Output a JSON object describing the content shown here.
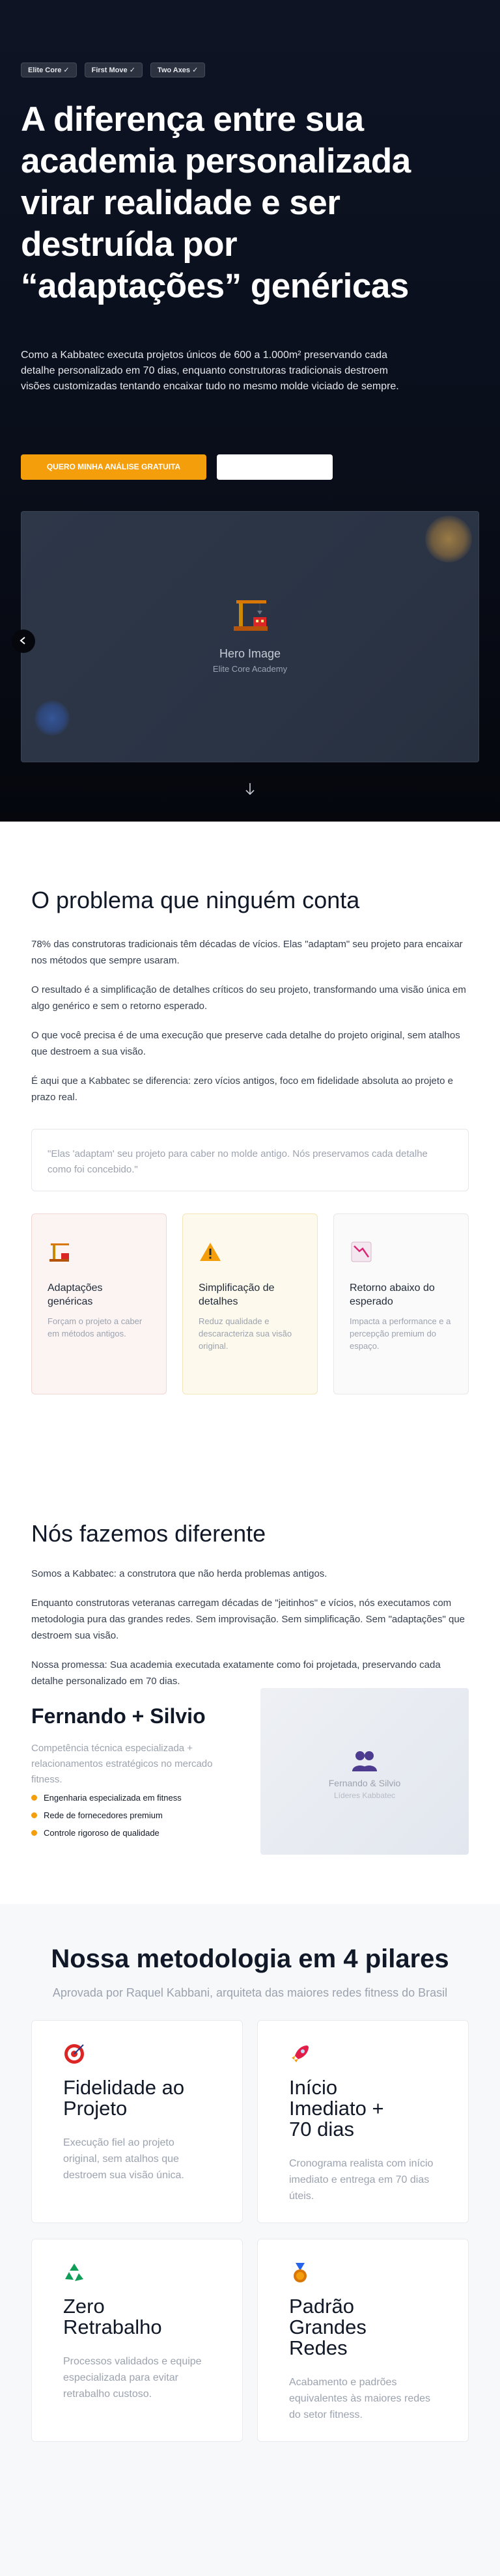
{
  "hero": {
    "badges": [
      "Elite Core ✓",
      "First Move ✓",
      "Two Axes ✓"
    ],
    "title_lines": [
      "A diferença entre sua",
      "academia personalizada",
      "virar realidade e ser",
      "destruída por",
      "“adaptações” genéricas"
    ],
    "subtitle": "Como a Kabbatec executa projetos únicos de 600 a 1.000m² preservando cada detalhe personalizado em 70 dias, enquanto construtoras tradicionais destroem visões customizadas tentando encaixar tudo no mesmo molde viciado de sempre.",
    "cta_primary": "QUERO MINHA ANÁLISE GRATUITA",
    "cta_secondary": "",
    "image": {
      "title": "Hero Image",
      "caption": "Elite Core Academy"
    },
    "side_arrow": "←",
    "down_arrow": "↓"
  },
  "problem": {
    "title": "O problema que ninguém conta",
    "paragraphs": [
      "78% das construtoras tradicionais têm décadas de vícios. Elas \"adaptam\" seu projeto para encaixar nos métodos que sempre usaram.",
      "O resultado é a simplificação de detalhes críticos do seu projeto, transformando uma visão única em algo genérico e sem o retorno esperado.",
      "O que você precisa é de uma execução que preserve cada detalhe do projeto original, sem atalhos que destroem a sua visão.",
      "É aqui que a Kabbatec se diferencia: zero vícios antigos, foco em fidelidade absoluta ao projeto e prazo real."
    ],
    "quote": "\"Elas 'adaptam' seu projeto para caber no molde antigo. Nós preservamos cada detalhe como foi concebido.\"",
    "cards": [
      {
        "title": "Adaptações genéricas",
        "desc": "Forçam o projeto a caber em métodos antigos.",
        "icon": "construction-crane-icon",
        "bg": "#fbf4f3",
        "border": "#f1d7d4"
      },
      {
        "title": "Simplificação de detalhes",
        "desc": "Reduz qualidade e descaracteriza sua visão original.",
        "icon": "warning-icon",
        "bg": "#fdf9ec",
        "border": "#f4e6b8"
      },
      {
        "title": "Retorno abaixo do esperado",
        "desc": "Impacta a performance e a percepção premium do espaço.",
        "icon": "chart-down-icon",
        "bg": "#fafafa",
        "border": "#e7e8ea"
      }
    ]
  },
  "different": {
    "title": "Nós fazemos diferente",
    "paragraphs": [
      "Somos a Kabbatec: a construtora que não herda problemas antigos.",
      "Enquanto construtoras veteranas carregam décadas de \"jeitinhos\" e vícios, nós executamos com metodologia pura das grandes redes. Sem improvisação. Sem simplificação. Sem \"adaptações\" que destroem sua visão.",
      "Nossa promessa: Sua academia executada exatamente como foi projetada, preservando cada detalhe personalizado em 70 dias."
    ],
    "founders": {
      "name": "Fernando + Silvio",
      "desc": "Competência técnica especializada + relacionamentos estratégicos no mercado fitness.",
      "features": [
        "Engenharia especializada em fitness",
        "Rede de fornecedores premium",
        "Controle rigoroso de qualidade"
      ],
      "image_name": "Fernando & Silvio",
      "image_caption": "Líderes Kabbatec"
    }
  },
  "method": {
    "title": "Nossa metodologia em 4 pilares",
    "subtitle": "Aprovada por Raquel Kabbani, arquiteta das maiores redes fitness do Brasil",
    "cards": [
      {
        "title_lines": [
          "Fidelidade ao",
          "Projeto"
        ],
        "desc": "Execução fiel ao projeto original, sem atalhos que destroem sua visão única.",
        "icon": "target-icon"
      },
      {
        "title_lines": [
          "Início",
          "Imediato +",
          "70 dias"
        ],
        "desc": "Cronograma realista com início imediato e entrega em 70 dias úteis.",
        "icon": "rocket-icon"
      },
      {
        "title_lines": [
          "Zero",
          "Retrabalho"
        ],
        "desc": "Processos validados e equipe especializada para evitar retrabalho custoso.",
        "icon": "recycle-icon"
      },
      {
        "title_lines": [
          "Padrão",
          "Grandes",
          "Redes"
        ],
        "desc": "Acabamento e padrões equivalentes às maiores redes do setor fitness.",
        "icon": "medal-icon"
      }
    ]
  }
}
